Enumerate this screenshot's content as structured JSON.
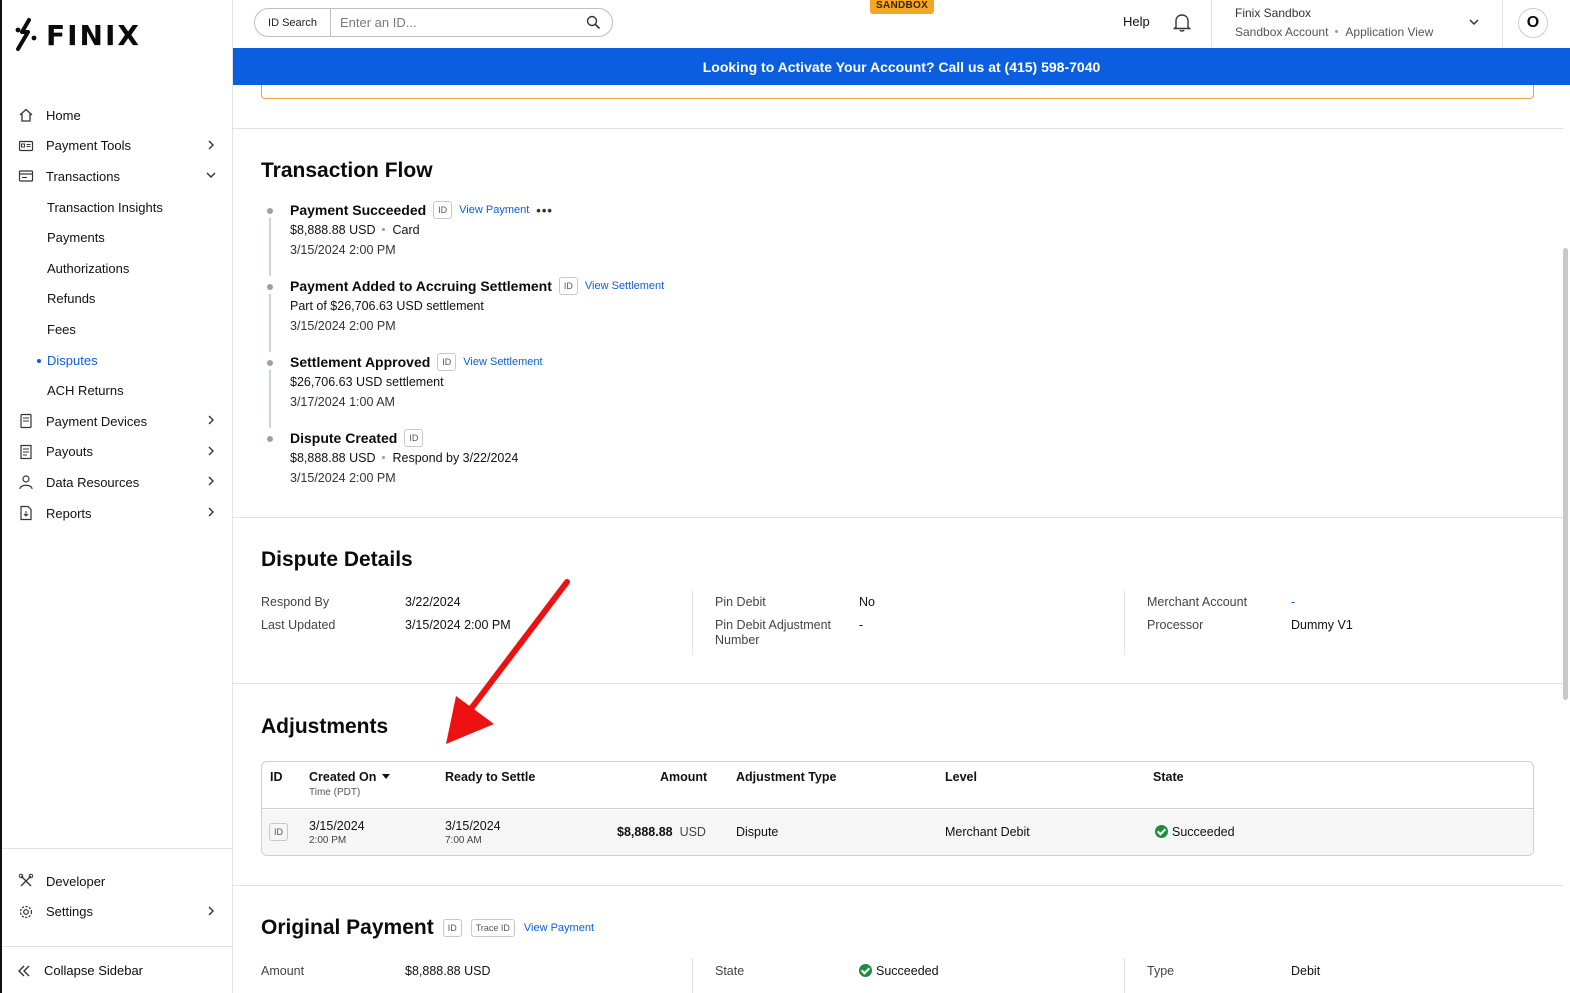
{
  "brand": {
    "name": "FINIX"
  },
  "header": {
    "search_label": "ID Search",
    "search_placeholder": "Enter an ID...",
    "env_badge": "SANDBOX",
    "help": "Help",
    "account_name": "Finix Sandbox",
    "account_type": "Sandbox Account",
    "account_view": "Application View",
    "avatar_initial": "O"
  },
  "banner": "Looking to Activate Your Account? Call us at (415) 598-7040",
  "sidebar": {
    "items": [
      {
        "label": "Home",
        "icon": "home-icon"
      },
      {
        "label": "Payment Tools",
        "icon": "payment-tools-icon",
        "chevron": "right"
      },
      {
        "label": "Transactions",
        "icon": "transactions-icon",
        "chevron": "down"
      },
      {
        "label": "Transaction Insights",
        "sub": true
      },
      {
        "label": "Payments",
        "sub": true
      },
      {
        "label": "Authorizations",
        "sub": true
      },
      {
        "label": "Refunds",
        "sub": true
      },
      {
        "label": "Fees",
        "sub": true
      },
      {
        "label": "Disputes",
        "sub": true,
        "active": true
      },
      {
        "label": "ACH Returns",
        "sub": true
      },
      {
        "label": "Payment Devices",
        "icon": "device-icon",
        "chevron": "right"
      },
      {
        "label": "Payouts",
        "icon": "payouts-icon",
        "chevron": "right"
      },
      {
        "label": "Data Resources",
        "icon": "user-icon",
        "chevron": "right"
      },
      {
        "label": "Reports",
        "icon": "reports-icon",
        "chevron": "right"
      }
    ],
    "bottom": [
      {
        "label": "Developer",
        "icon": "developer-icon"
      },
      {
        "label": "Settings",
        "icon": "gear-icon",
        "chevron": "right"
      }
    ],
    "collapse": "Collapse Sidebar"
  },
  "flow": {
    "title": "Transaction Flow",
    "steps": [
      {
        "title": "Payment Succeeded",
        "chip": "ID",
        "link": "View Payment",
        "more": "•••",
        "line_a": "$8,888.88 USD",
        "line_b": "Card",
        "time": "3/15/2024 2:00 PM"
      },
      {
        "title": "Payment Added to Accruing Settlement",
        "chip": "ID",
        "link": "View Settlement",
        "line_a": "Part of $26,706.63 USD settlement",
        "time": "3/15/2024 2:00 PM"
      },
      {
        "title": "Settlement Approved",
        "chip": "ID",
        "link": "View Settlement",
        "line_a": "$26,706.63 USD settlement",
        "time": "3/17/2024 1:00 AM"
      },
      {
        "title": "Dispute Created",
        "chip": "ID",
        "line_a": "$8,888.88 USD",
        "line_b": "Respond by 3/22/2024",
        "time": "3/15/2024 2:00 PM"
      }
    ]
  },
  "dispute_details": {
    "title": "Dispute Details",
    "respond_by_label": "Respond By",
    "respond_by": "3/22/2024",
    "last_updated_label": "Last Updated",
    "last_updated": "3/15/2024 2:00 PM",
    "pin_debit_label": "Pin Debit",
    "pin_debit": "No",
    "pin_adj_label_1": "Pin Debit Adjustment",
    "pin_adj_label_2": "Number",
    "pin_adj": "-",
    "merchant_account_label": "Merchant Account",
    "merchant_account": "-",
    "processor_label": "Processor",
    "processor": "Dummy V1"
  },
  "adjustments": {
    "title": "Adjustments",
    "columns": {
      "id": "ID",
      "created_on": "Created On",
      "created_sub": "Time (PDT)",
      "ready": "Ready to Settle",
      "amount": "Amount",
      "type": "Adjustment Type",
      "level": "Level",
      "state": "State"
    },
    "row": {
      "chip": "ID",
      "created_date": "3/15/2024",
      "created_time": "2:00 PM",
      "ready_date": "3/15/2024",
      "ready_time": "7:00 AM",
      "amount": "$8,888.88",
      "currency": "USD",
      "type": "Dispute",
      "level": "Merchant Debit",
      "state": "Succeeded"
    }
  },
  "original_payment": {
    "title": "Original Payment",
    "chip_id": "ID",
    "chip_trace": "Trace ID",
    "link": "View Payment",
    "amount_label": "Amount",
    "amount": "$8,888.88 USD",
    "state_label": "State",
    "state": "Succeeded",
    "type_label": "Type",
    "type": "Debit"
  },
  "colors": {
    "accent": "#0b5ee0",
    "link": "#0b5ed7",
    "sandbox": "#f5a623",
    "success": "#1e8e3e",
    "annotation_arrow": "#ee1111"
  }
}
